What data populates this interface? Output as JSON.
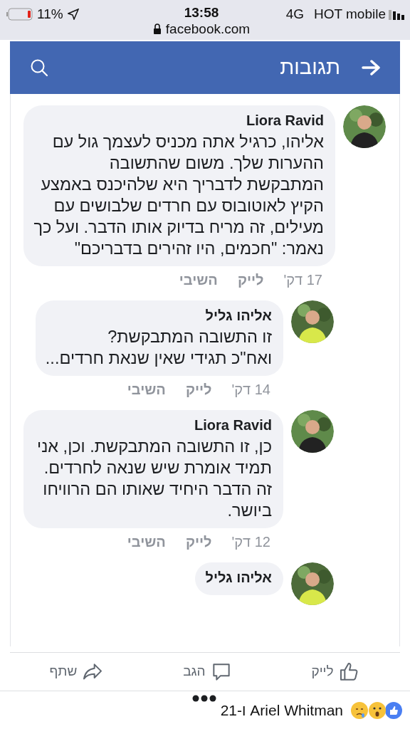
{
  "status_bar": {
    "battery": "11%",
    "time": "13:58",
    "url": "facebook.com",
    "network": "4G",
    "carrier": "HOT mobile"
  },
  "header": {
    "title": "תגובות"
  },
  "comments": [
    {
      "name": "Liora Ravid",
      "text": "אליהו, כרגיל אתה מכניס לעצמך גול עם ההערות שלך. משום שהתשובה המתבקשת לדבריך היא שלהיכנס באמצע הקיץ לאוטובוס עם חרדים שלבושים עם מעילים, זה מריח בדיוק אותו הדבר.  ועל כך נאמר: \"חכמים, היו זהירים בדבריכם\"",
      "time": "17 דק'",
      "like": "לייק",
      "reply": "השיבי",
      "replies": [
        {
          "name": "אליהו גליל",
          "text": "זו התשובה המתבקשת?\nואח\"כ תגידי שאין שנאת חרדים...",
          "time": "14 דק'",
          "like": "לייק",
          "reply": "השיבי"
        },
        {
          "name": "Liora Ravid",
          "text": "כן, זו התשובה המתבקשת. וכן, אני תמיד אומרת שיש שנאה לחרדים. זה הדבר היחיד שאותו הם הרוויחו ביושר.",
          "time": "12 דק'",
          "like": "לייק",
          "reply": "השיבי"
        },
        {
          "name": "אליהו גליל"
        }
      ]
    }
  ],
  "actions": [
    {
      "kind": "like",
      "label": "לייק"
    },
    {
      "kind": "comment",
      "label": "הגב"
    },
    {
      "kind": "share",
      "label": "שתף"
    }
  ],
  "reactions": {
    "summary": "Ariel Whitman ו-21"
  }
}
